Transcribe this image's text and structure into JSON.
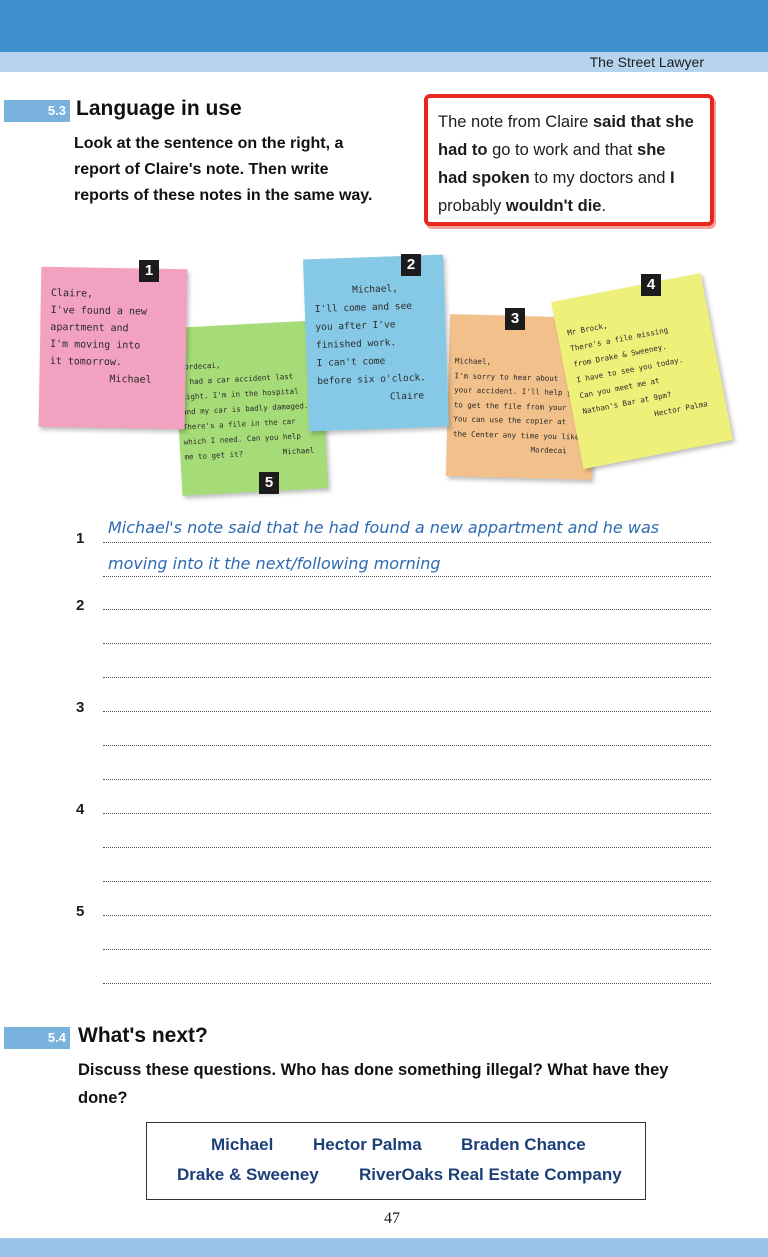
{
  "header": {
    "book_title": "The Street Lawyer"
  },
  "section_53": {
    "tag": "5.3",
    "title": "Language in use",
    "instructions": [
      "Look at the sentence on the right, a",
      "report of Claire's note. Then write",
      "reports of these notes in the same way."
    ],
    "example_lines": [
      [
        "The note from Claire ",
        "said that she"
      ],
      [
        "had to",
        " go to work and that ",
        "she"
      ],
      [
        "had spoken",
        " to my doctors and ",
        "I"
      ],
      [
        "probably ",
        "wouldn't die",
        "."
      ]
    ]
  },
  "notes": [
    {
      "number": "1",
      "color": "#f2a2c0",
      "lines": [
        "Claire,",
        "I've found a new",
        "apartment and",
        "I'm moving into",
        "it tomorrow.",
        "Michael"
      ]
    },
    {
      "number": "2",
      "color": "#86c9e6",
      "lines": [
        "Michael,",
        "I'll come and see",
        "you after I've",
        "finished work.",
        "I can't come",
        "before six o'clock.",
        "Claire"
      ]
    },
    {
      "number": "3",
      "color": "#f2c08a",
      "lines": [
        "Michael,",
        "I'm sorry to hear about",
        "your accident. I'll help you",
        "to get the file from your car.",
        "You can use the copier at",
        "the Center any time you like.",
        "Mordecai"
      ]
    },
    {
      "number": "4",
      "color": "#eef07a",
      "lines": [
        "Mr Brock,",
        "There's a file missing",
        "from Drake & Sweeney.",
        "I have to see you today.",
        "Can you meet me at",
        "Nathan's Bar at 9pm?",
        "Hector Palma"
      ]
    },
    {
      "number": "5",
      "color": "#a6dc78",
      "lines": [
        "Mordecai,",
        "I had a car accident last",
        "night. I'm in the hospital",
        "and my car is badly damaged.",
        "There's a file in the car",
        "which I need. Can you help",
        "me to get it?",
        "Michael"
      ]
    }
  ],
  "exercise": {
    "numbers": [
      "1",
      "2",
      "3",
      "4",
      "5"
    ],
    "answer_1": [
      "Michael's note said that he had found a new appartment and he was",
      "moving into it the next/following morning"
    ]
  },
  "section_54": {
    "tag": "5.4",
    "title": "What's next?",
    "text": "Discuss these questions. Who has done something illegal? What have they done?",
    "names": [
      "Michael",
      "Hector Palma",
      "Braden Chance",
      "Drake & Sweeney",
      "RiverOaks Real Estate Company"
    ]
  },
  "footer": {
    "page_number": "47"
  },
  "colors": {
    "accent_blue": "#3f8fcf",
    "highlight_red": "#e8261c",
    "handwriting_blue": "#2d6ab4"
  }
}
